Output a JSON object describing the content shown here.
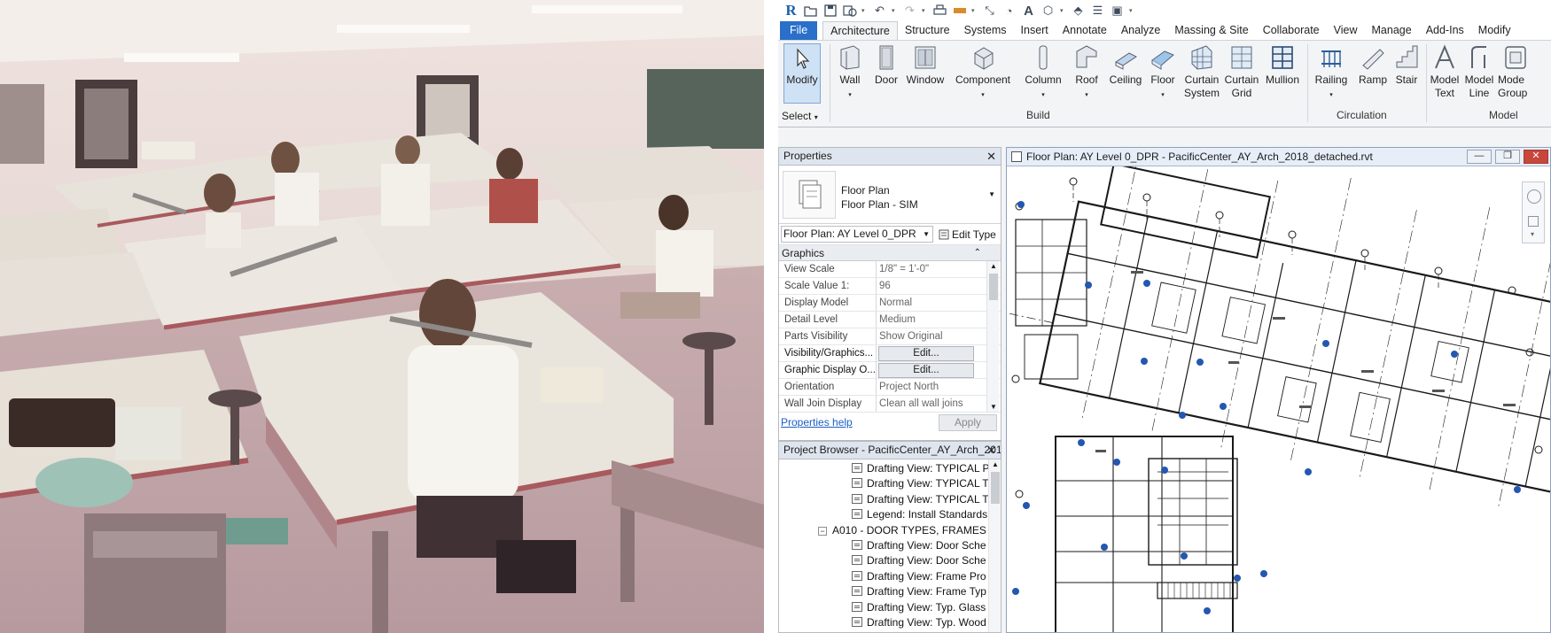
{
  "quick_access": {
    "logo": "R",
    "icons": [
      "open-icon",
      "save-icon",
      "sync-icon",
      "undo-icon",
      "redo-icon",
      "print-icon",
      "measure-icon",
      "dimension-icon",
      "tag-icon",
      "text-icon",
      "3d-view-icon",
      "section-icon",
      "switch-windows-icon",
      "close-inactive-icon"
    ]
  },
  "tabs": [
    "File",
    "Architecture",
    "Structure",
    "Systems",
    "Insert",
    "Annotate",
    "Analyze",
    "Massing & Site",
    "Collaborate",
    "View",
    "Manage",
    "Add-Ins",
    "Modify"
  ],
  "active_tab": "Architecture",
  "ribbon": {
    "modify": "Modify",
    "select": "Select",
    "build": {
      "label": "Build",
      "items": [
        "Wall",
        "Door",
        "Window",
        "Component",
        "Column",
        "Roof",
        "Ceiling",
        "Floor",
        "Curtain System",
        "Curtain Grid",
        "Mullion"
      ]
    },
    "circulation": {
      "label": "Circulation",
      "items": [
        "Railing",
        "Ramp",
        "Stair"
      ]
    },
    "model": {
      "label": "Model",
      "items": [
        "Model Text",
        "Model Line",
        "Mode Group"
      ]
    }
  },
  "properties": {
    "title": "Properties",
    "type_line1": "Floor Plan",
    "type_line2": "Floor Plan - SIM",
    "view_selector": "Floor Plan: AY Level 0_DPR",
    "edit_type": "Edit Type",
    "section": "Graphics",
    "rows": [
      {
        "name": "View Scale",
        "value": "1/8\" = 1'-0\""
      },
      {
        "name": "Scale Value    1:",
        "value": "96"
      },
      {
        "name": "Display Model",
        "value": "Normal"
      },
      {
        "name": "Detail Level",
        "value": "Medium"
      },
      {
        "name": "Parts Visibility",
        "value": "Show Original"
      },
      {
        "name": "Visibility/Graphics...",
        "value": "Edit..."
      },
      {
        "name": "Graphic Display O...",
        "value": "Edit..."
      },
      {
        "name": "Orientation",
        "value": "Project North"
      },
      {
        "name": "Wall Join Display",
        "value": "Clean all wall joins"
      }
    ],
    "help": "Properties help",
    "apply": "Apply"
  },
  "browser": {
    "title": "Project Browser - PacificCenter_AY_Arch_2018...",
    "items": [
      {
        "text": "Drafting View: TYPICAL Pl",
        "kind": "view"
      },
      {
        "text": "Drafting View: TYPICAL T",
        "kind": "view"
      },
      {
        "text": "Drafting View: TYPICAL T",
        "kind": "view"
      },
      {
        "text": "Legend: Install Standards",
        "kind": "legend"
      },
      {
        "text": "A010 - DOOR TYPES, FRAMES &",
        "kind": "sheet"
      },
      {
        "text": "Drafting View: Door Sche",
        "kind": "view"
      },
      {
        "text": "Drafting View: Door Sche",
        "kind": "view"
      },
      {
        "text": "Drafting View: Frame Pro",
        "kind": "view"
      },
      {
        "text": "Drafting View: Frame Typ",
        "kind": "view"
      },
      {
        "text": "Drafting View: Typ. Glass",
        "kind": "view"
      },
      {
        "text": "Drafting View: Typ. Wood",
        "kind": "view"
      }
    ]
  },
  "view_window": {
    "title": "Floor Plan: AY Level 0_DPR - PacificCenter_AY_Arch_2018_detached.rvt",
    "controls": [
      "minimize",
      "restore",
      "close"
    ]
  },
  "colors": {
    "file_tab": "#2a6fc9",
    "panel_header": "#dfe5ee",
    "view_title": "#e7eef8",
    "close_button": "#c9463c",
    "link": "#1a5fc4"
  }
}
